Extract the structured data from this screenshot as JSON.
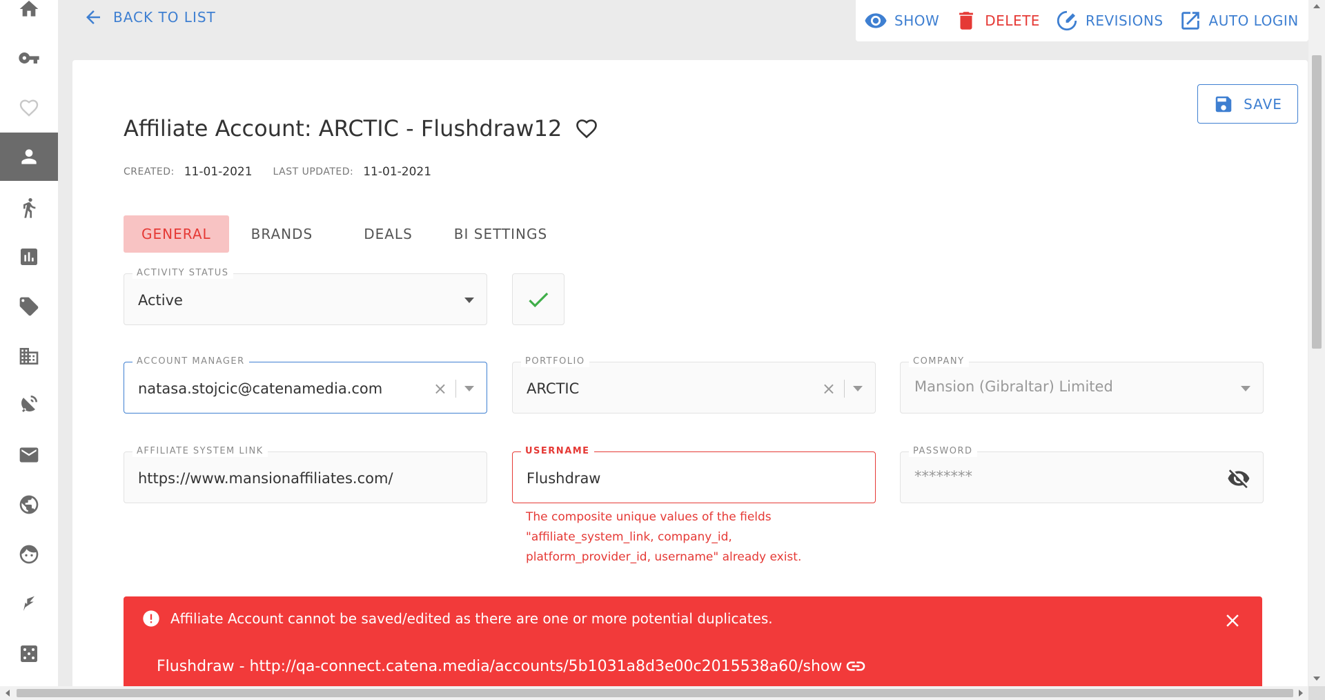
{
  "colors": {
    "accent": "#3e7fd1",
    "danger": "#e53935",
    "alert_bg": "#f23a3a",
    "tab_active_bg": "#f8c3c3",
    "success": "#3fae49"
  },
  "sidebar": {
    "items": [
      {
        "icon": "home-icon"
      },
      {
        "icon": "key-icon"
      },
      {
        "icon": "heart-icon"
      },
      {
        "icon": "person-icon",
        "active": true
      },
      {
        "icon": "running-icon"
      },
      {
        "icon": "bar-chart-icon"
      },
      {
        "icon": "tag-icon"
      },
      {
        "icon": "building-icon"
      },
      {
        "icon": "satellite-dish-icon"
      },
      {
        "icon": "mail-icon"
      },
      {
        "icon": "globe-icon"
      },
      {
        "icon": "face-icon"
      },
      {
        "icon": "flag-icon"
      },
      {
        "icon": "dice-icon"
      }
    ]
  },
  "header": {
    "back_label": "BACK TO LIST",
    "actions": {
      "show": "SHOW",
      "delete": "DELETE",
      "revisions": "REVISIONS",
      "auto_login": "AUTO LOGIN"
    }
  },
  "page": {
    "title": "Affiliate Account: ARCTIC - Flushdraw12",
    "save_label": "SAVE",
    "created_label": "CREATED:",
    "created_value": "11-01-2021",
    "updated_label": "LAST UPDATED:",
    "updated_value": "11-01-2021"
  },
  "tabs": [
    {
      "label": "GENERAL",
      "active": true
    },
    {
      "label": "BRANDS"
    },
    {
      "label": "DEALS"
    },
    {
      "label": "BI SETTINGS"
    }
  ],
  "form": {
    "activity_status": {
      "label": "ACTIVITY STATUS",
      "value": "Active"
    },
    "account_manager": {
      "label": "ACCOUNT MANAGER",
      "value": "natasa.stojcic@catenamedia.com"
    },
    "portfolio": {
      "label": "PORTFOLIO",
      "value": "ARCTIC"
    },
    "company": {
      "label": "COMPANY",
      "value": "Mansion (Gibraltar) Limited"
    },
    "affiliate_system_link": {
      "label": "AFFILIATE SYSTEM LINK",
      "value": "https://www.mansionaffiliates.com/"
    },
    "username": {
      "label": "USERNAME",
      "value": "Flushdraw",
      "error_lines": [
        "The composite unique values of the fields",
        "\"affiliate_system_link, company_id,",
        "platform_provider_id, username\" already exist."
      ]
    },
    "password": {
      "label": "PASSWORD",
      "value": "********"
    }
  },
  "alert": {
    "message": "Affiliate Account cannot be saved/edited as there are one or more potential duplicates.",
    "duplicate": "Flushdraw - http://qa-connect.catena.media/accounts/5b1031a8d3e00c2015538a60/show"
  }
}
